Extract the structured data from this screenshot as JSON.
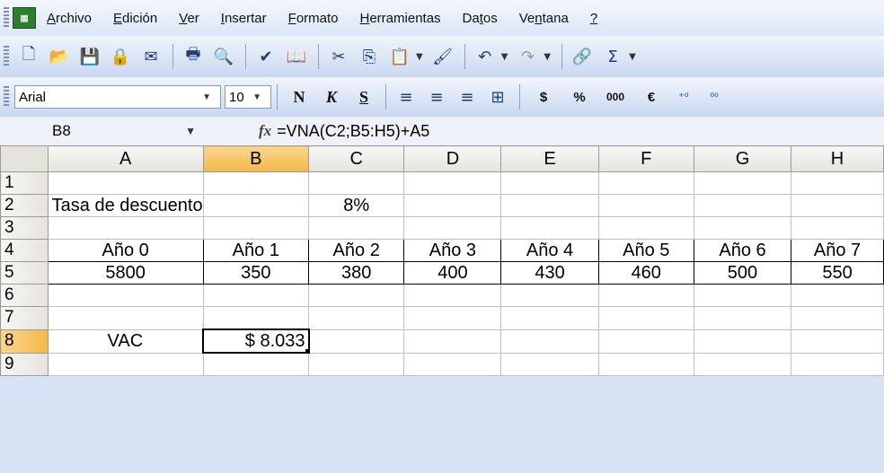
{
  "menu": {
    "items": [
      "Archivo",
      "Edición",
      "Ver",
      "Insertar",
      "Formato",
      "Herramientas",
      "Datos",
      "Ventana",
      "?"
    ],
    "mnemonic": [
      0,
      0,
      0,
      0,
      0,
      0,
      2,
      2,
      0
    ]
  },
  "font_toolbar": {
    "font_name": "Arial",
    "font_size": "10",
    "bold": "N",
    "italic": "K",
    "underline": "S",
    "currency": "$",
    "percent": "%",
    "thousands": "000",
    "euro": "€"
  },
  "formula_bar": {
    "name_box": "B8",
    "fx": "fx",
    "formula": "=VNA(C2;B5:H5)+A5"
  },
  "sheet": {
    "columns": [
      "A",
      "B",
      "C",
      "D",
      "E",
      "F",
      "G",
      "H"
    ],
    "selected_column": "B",
    "rows": [
      "1",
      "2",
      "3",
      "4",
      "5",
      "6",
      "7",
      "8",
      "9"
    ],
    "selected_row": "8",
    "cells": {
      "A2": "Tasa de descuento",
      "C2": "8%",
      "years": [
        "Año 0",
        "Año 1",
        "Año 2",
        "Año 3",
        "Año 4",
        "Año 5",
        "Año 6",
        "Año 7"
      ],
      "flows": [
        "5800",
        "350",
        "380",
        "400",
        "430",
        "460",
        "500",
        "550"
      ],
      "A8": "VAC",
      "B8": "$ 8.033"
    }
  }
}
